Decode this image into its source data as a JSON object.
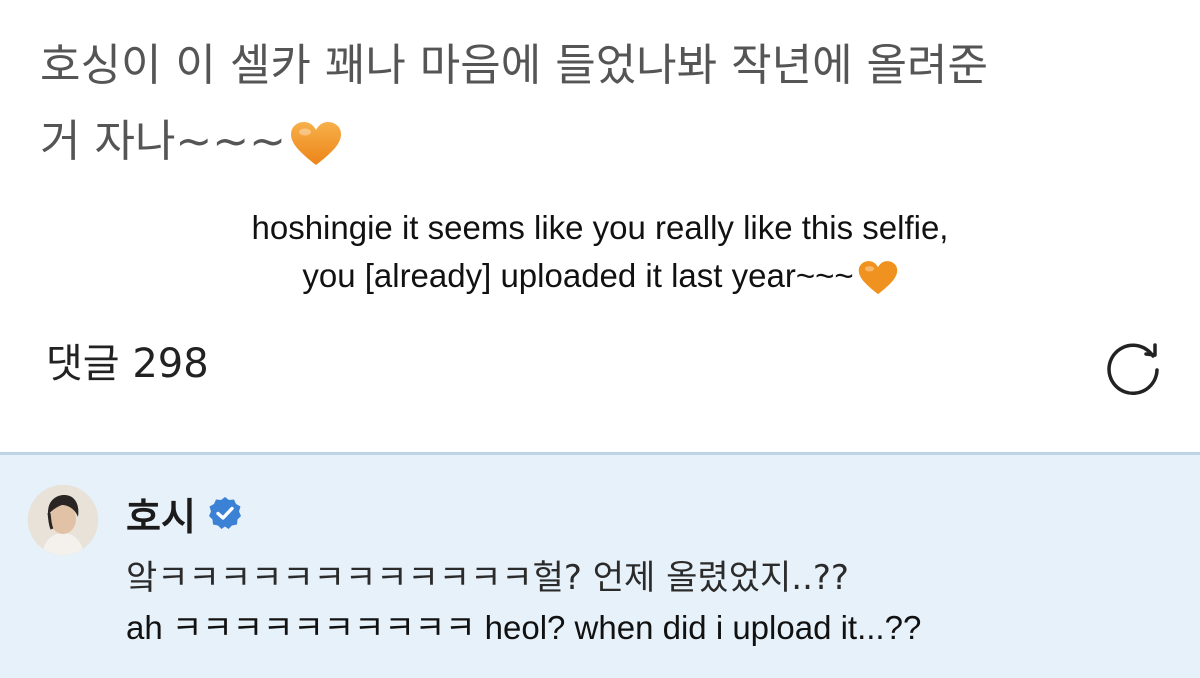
{
  "post": {
    "body_line1": "호싱이 이 셀카 꽤나 마음에 들었나봐 작년에 올려준",
    "body_line2": "거 자나~~~",
    "heart_icon": "orange-heart-icon",
    "heart_color": "#f39a2b"
  },
  "translation": {
    "line1": "hoshingie it seems like you really like this selfie,",
    "line2": "you [already] uploaded it last year~~~"
  },
  "comments": {
    "label": "댓글",
    "count": "298",
    "refresh_icon": "refresh-icon"
  },
  "comment": {
    "author": "호시",
    "verified_icon": "verified-badge-icon",
    "verified_color": "#3b82d6",
    "text": "앜ㅋㅋㅋㅋㅋㅋㅋㅋㅋㅋㅋㅋ헐? 언제 올렸었지..??",
    "translation": "ah ㅋㅋㅋㅋㅋㅋㅋㅋㅋㅋ heol? when did i upload it...??",
    "card_bg": "#e7f1f9"
  }
}
